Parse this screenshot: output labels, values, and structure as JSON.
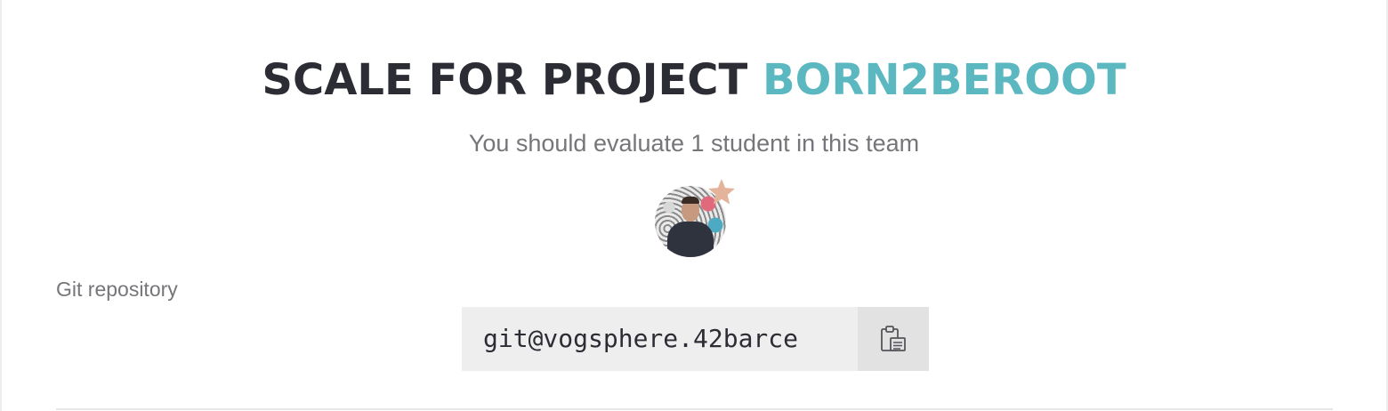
{
  "header": {
    "title_prefix": "SCALE FOR PROJECT",
    "project_name": "BORN2BEROOT",
    "subtitle": "You should evaluate 1 student in this team"
  },
  "team": {
    "avatar_icon": "user-avatar",
    "badge_icon": "star-icon"
  },
  "repository": {
    "label": "Git repository",
    "value": "git@vogsphere.42barce",
    "copy_icon": "clipboard-icon"
  },
  "colors": {
    "title": "#2c2c34",
    "accent": "#5bb8c0",
    "muted_text": "#76767a",
    "star": "#e3b49a",
    "field_bg": "#eeeeee"
  }
}
